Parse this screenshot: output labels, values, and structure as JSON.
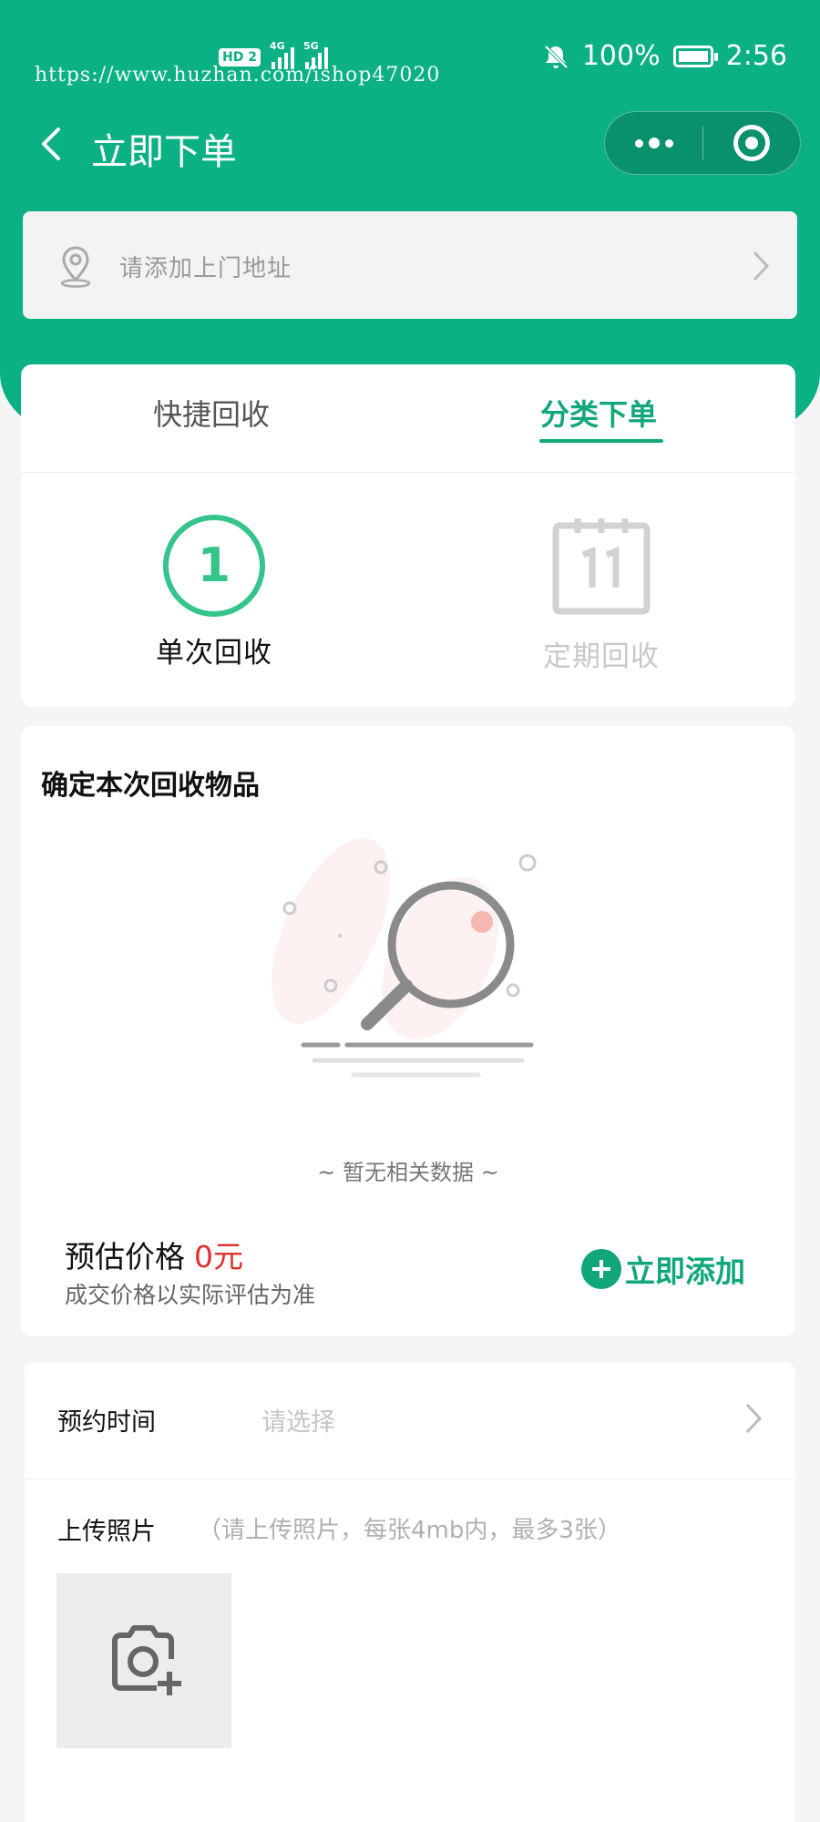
{
  "status_bar": {
    "watermark": "https://www.huzhan.com/ishop47020",
    "hd_badge": "HD",
    "sim_badge": "2",
    "net1": "4G",
    "net2": "5G",
    "battery": "100%",
    "time": "2:56"
  },
  "navbar": {
    "title": "立即下单"
  },
  "address": {
    "placeholder": "请添加上门地址"
  },
  "tabs": [
    {
      "label": "快捷回收",
      "active": false
    },
    {
      "label": "分类下单",
      "active": true
    }
  ],
  "modes": {
    "single": {
      "number": "1",
      "label": "单次回收"
    },
    "periodic": {
      "label": "定期回收"
    }
  },
  "items": {
    "title": "确定本次回收物品",
    "empty_text": "~ 暂无相关数据 ~",
    "price_label": "预估价格",
    "price_value": "0元",
    "price_note": "成交价格以实际评估为准",
    "add_label": "立即添加"
  },
  "form": {
    "time_label": "预约时间",
    "time_placeholder": "请选择",
    "photo_label": "上传照片",
    "photo_hint": "（请上传照片，每张4mb内，最多3张）"
  },
  "colors": {
    "brand": "#0bb084",
    "accent": "#12a77b",
    "price": "#e02d2d"
  }
}
